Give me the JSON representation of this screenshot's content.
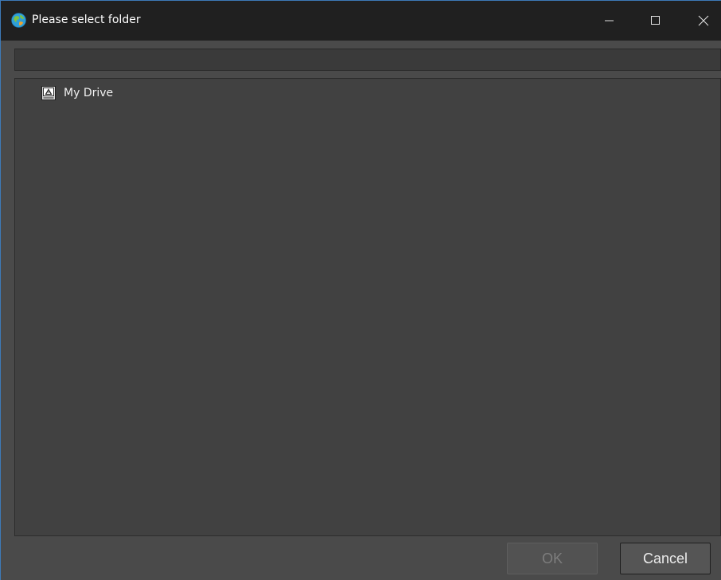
{
  "window": {
    "title": "Please select folder",
    "controls": {
      "minimize": "minimize-icon",
      "maximize": "maximize-icon",
      "close": "close-icon"
    }
  },
  "path_bar": {
    "value": ""
  },
  "tree": {
    "items": [
      {
        "label": "My Drive",
        "icon": "drive-icon"
      }
    ]
  },
  "buttons": {
    "ok_label": "OK",
    "ok_enabled": false,
    "cancel_label": "Cancel"
  },
  "colors": {
    "titlebar": "#202020",
    "window_bg": "#4a4a4a",
    "panel_bg": "#414141",
    "accent_border": "#3d7ab8"
  }
}
